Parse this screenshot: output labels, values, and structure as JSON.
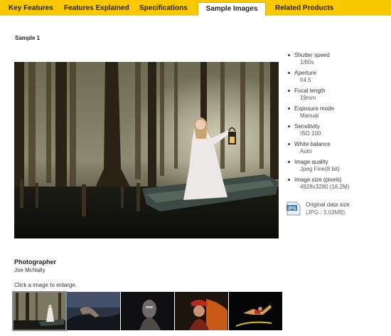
{
  "tabs": [
    {
      "label": "Key Features"
    },
    {
      "label": "Features Explained"
    },
    {
      "label": "Specifications"
    },
    {
      "label": "Sample Images",
      "active": true
    },
    {
      "label": "Related Products"
    }
  ],
  "colors": {
    "tab_bar": "#f8c800",
    "background": "#ffffff"
  },
  "sample": {
    "title": "Sample 1"
  },
  "specs": [
    {
      "label": "Shutter speed",
      "value": "1/60s"
    },
    {
      "label": "Aperture",
      "value": "f/4.5"
    },
    {
      "label": "Focal length",
      "value": "19mm"
    },
    {
      "label": "Exposure mode",
      "value": "Manual"
    },
    {
      "label": "Sensitivity",
      "value": "ISO 100"
    },
    {
      "label": "White balance",
      "value": "Auto"
    },
    {
      "label": "Image quality",
      "value": "Jpeg Fine(8 bit)"
    },
    {
      "label": "Image size (pixels)",
      "value": "4928x3280 (16.2M)"
    }
  ],
  "original": {
    "icon_text": "JPG",
    "label": "Original data size",
    "size": "(JPG : 3.03MB)"
  },
  "photographer": {
    "heading": "Photographer",
    "name": "Joe McNally"
  },
  "thumbnails": {
    "instruction": "Click a image to enlarge.",
    "items": [
      {
        "subject": "woman in white dress on boat in swamp",
        "selected": true
      },
      {
        "subject": "dancer posing on rocks at dusk"
      },
      {
        "subject": "woman with face paint in dark"
      },
      {
        "subject": "man in red hat with fire"
      },
      {
        "subject": "athlete leaping against black background"
      }
    ]
  }
}
